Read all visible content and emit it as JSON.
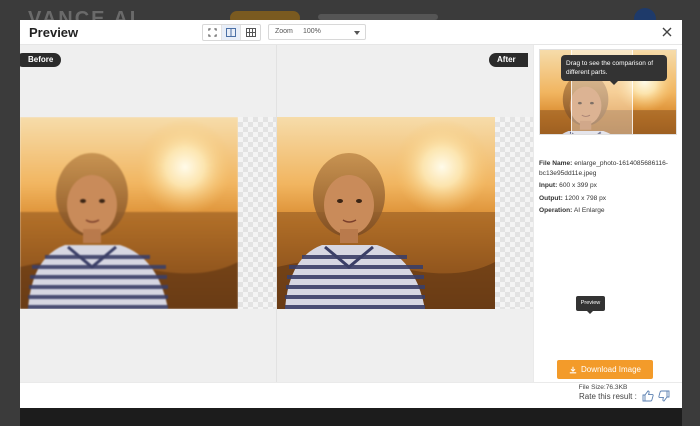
{
  "background": {
    "logo_text": "VANCE AI"
  },
  "modal": {
    "title": "Preview",
    "zoom_label": "Zoom",
    "zoom_value": "100%",
    "before_label": "Before",
    "after_label": "After"
  },
  "info": {
    "tooltip": "Drag to see the comparison of different parts.",
    "file_name_label": "File Name:",
    "file_name": "enlarge_photo-1614085686116-bc13e95dd11e.jpeg",
    "input_label": "Input:",
    "input_value": "600 x 399 px",
    "output_label": "Output:",
    "output_value": "1200 x 798 px",
    "operation_label": "Operation:",
    "operation_value": "AI Enlarge",
    "preview_tip": "Preview",
    "download_label": "Download Image",
    "file_size": "File Size:76.3KB"
  },
  "footer": {
    "rate_label": "Rate this result :"
  },
  "colors": {
    "accent": "#f39b2a",
    "dark_pill": "#2b2b2b"
  },
  "icons": {
    "fit": "fit-screen-icon",
    "side_by_side": "split-view-icon",
    "grid": "grid-view-icon",
    "close": "close-icon",
    "download": "download-icon",
    "like": "thumbs-up-icon",
    "dislike": "thumbs-down-icon"
  }
}
